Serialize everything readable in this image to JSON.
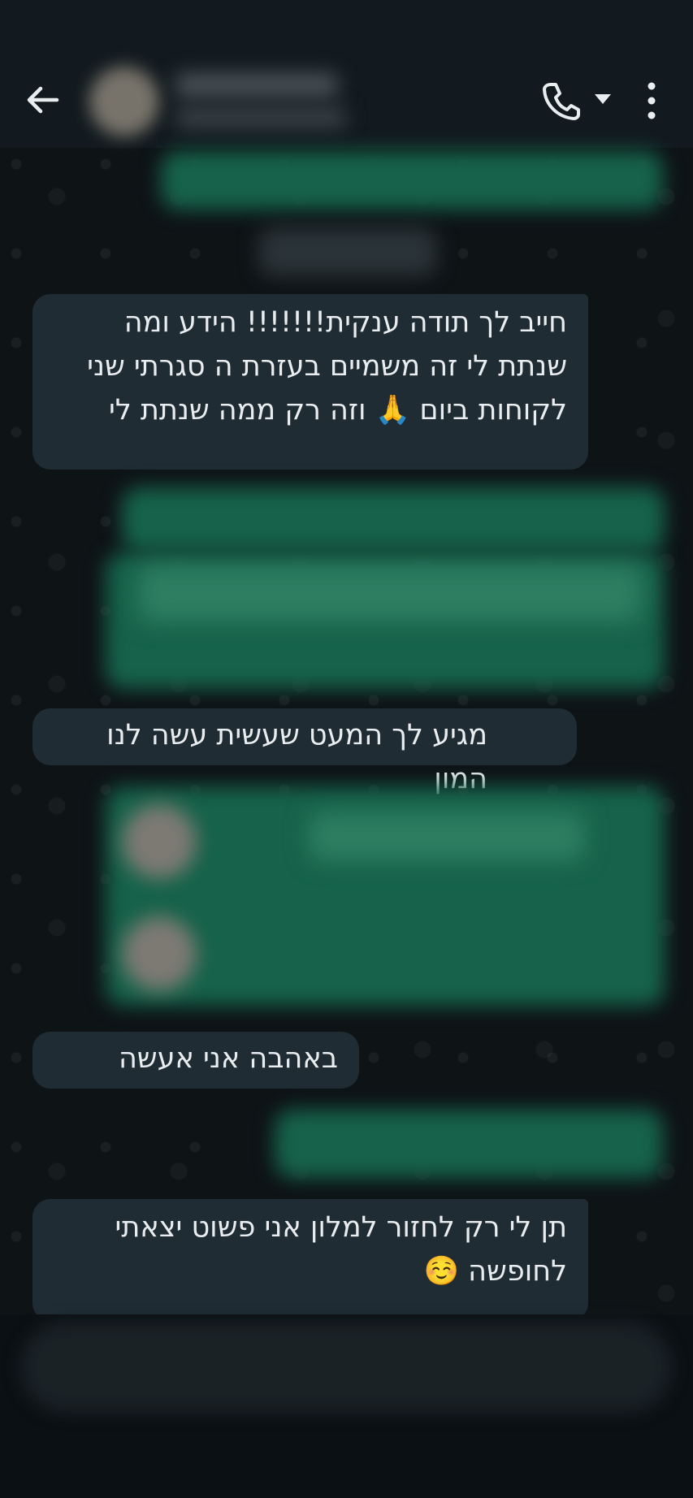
{
  "header": {
    "back_icon": "arrow-left-icon",
    "call_icon": "phone-icon",
    "caret_icon": "caret-down-icon",
    "menu_icon": "more-vertical-icon",
    "contact_name": "",
    "contact_status": ""
  },
  "messages": [
    {
      "direction": "incoming",
      "text": "חייב לך תודה ענקית!!!!!!! הידע ומה שנתת לי זה משמיים בעזרת ה סגרתי שני לקוחות ביום 🙏 וזה רק ממה שנתת לי"
    },
    {
      "direction": "incoming",
      "text": "מגיע לך המעט שעשית עשה לנו המון"
    },
    {
      "direction": "incoming",
      "text": "באהבה אני אעשה"
    },
    {
      "direction": "incoming",
      "text": "תן לי רק לחזור למלון אני פשוט יצאתי לחופשה ☺️"
    }
  ],
  "colors": {
    "background": "#0b1014",
    "header": "#121a1f",
    "incoming_bubble": "#1f2c33",
    "outgoing_bubble": "#005c4b",
    "text": "#e9edef"
  }
}
